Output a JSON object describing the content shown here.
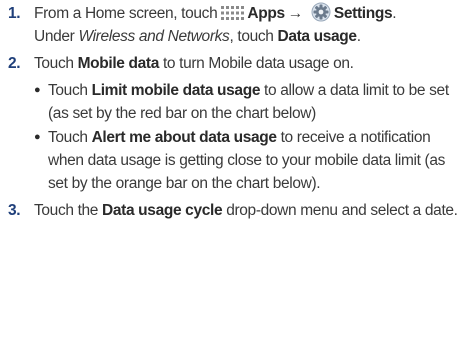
{
  "steps": [
    {
      "number": "1.",
      "line1": {
        "t1": "From a Home screen, touch",
        "apps_icon": "apps-grid-icon",
        "apps": "Apps",
        "arrow": "→",
        "settings_icon": "settings-gear-icon",
        "settings": "Settings",
        "period": "."
      },
      "line2": {
        "t1": "Under ",
        "wireless": "Wireless and Networks",
        "t2": ", touch ",
        "data_usage": "Data usage",
        "period": "."
      }
    },
    {
      "number": "2.",
      "t1": "Touch ",
      "mobile_data": "Mobile data",
      "t2": " to turn Mobile data usage on.",
      "bullets": [
        {
          "t1": "Touch ",
          "bold": "Limit mobile data usage",
          "t2": " to allow a data limit to be set (as set by the red bar on the chart below)"
        },
        {
          "t1": "Touch ",
          "bold": "Alert me about data usage",
          "t2": " to receive a notification when data usage is getting close to your mobile data limit (as set by the orange bar on the chart below)."
        }
      ]
    },
    {
      "number": "3.",
      "t1": "Touch the ",
      "bold": "Data usage cycle",
      "t2": " drop-down menu and select a date."
    }
  ],
  "colors": {
    "step_number": "#1f3f7a",
    "text": "#3a3a3a",
    "apps_icon": "#8a8a8a",
    "settings_icon": "#6b7a8c"
  }
}
